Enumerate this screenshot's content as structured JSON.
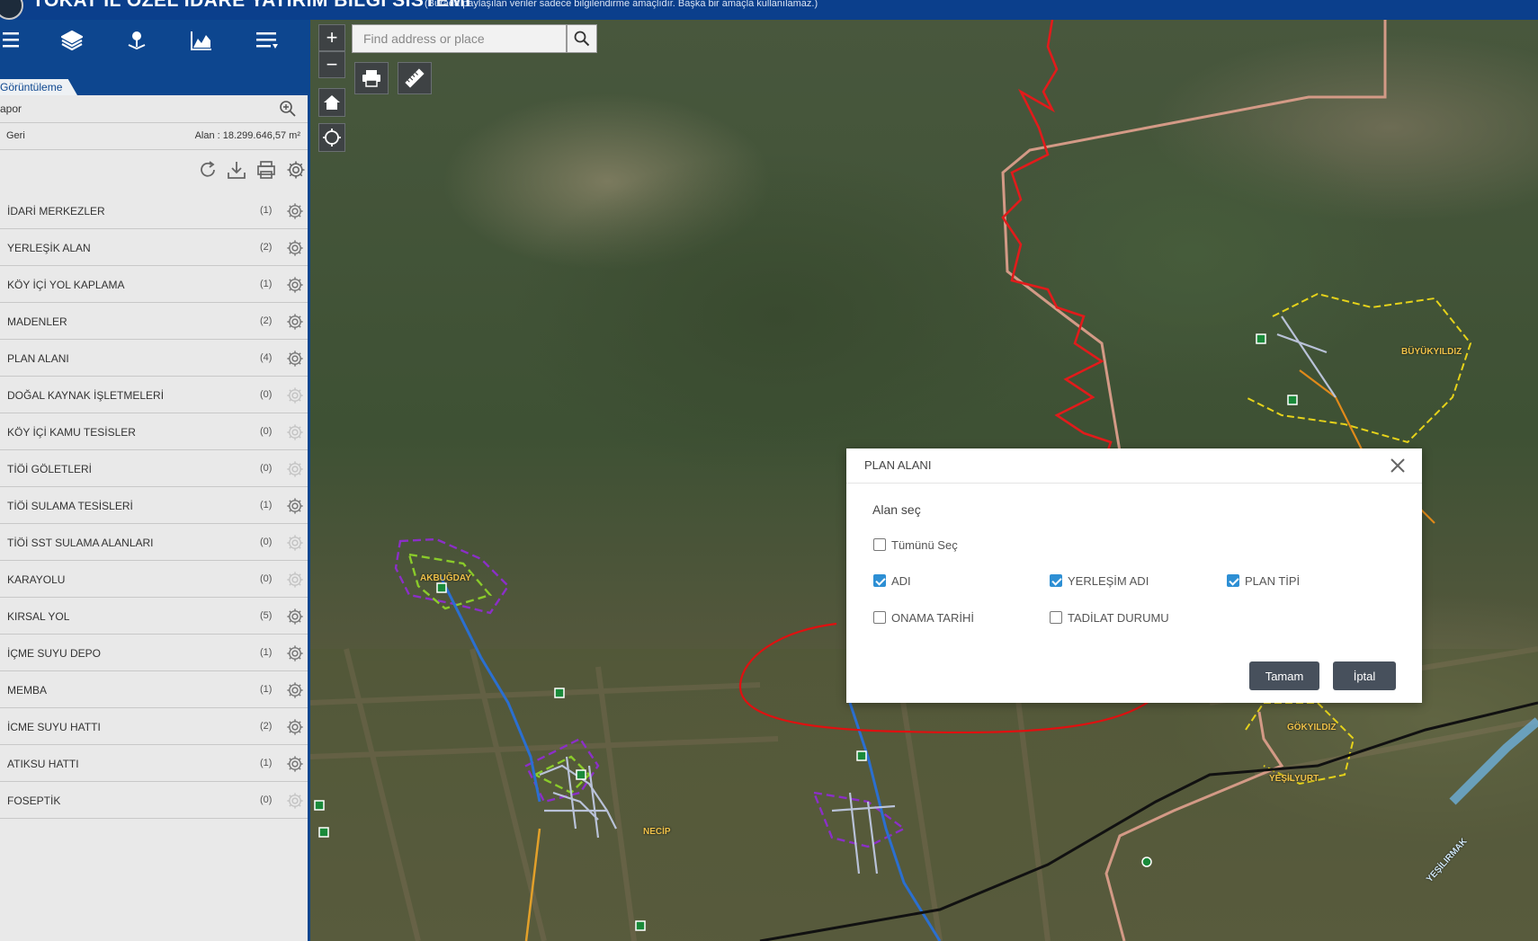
{
  "header": {
    "title": "TOKAT İL ÖZEL İDARE YATIRIM BİLGİ SİSTEMİ",
    "subtitle": "(Burada paylaşılan veriler sadece bilgilendirme amaçlıdır. Başka bir amaçla kullanılamaz.)"
  },
  "toolbar": {
    "icons": [
      "list-icon",
      "layers-icon",
      "location-pin-icon",
      "chart-icon",
      "menu-icon"
    ]
  },
  "panel": {
    "tab_label": "Görüntüleme",
    "rapor_label": "apor",
    "back_label": "Geri",
    "area_label": "Alan : 18.299.646,57 m²"
  },
  "layers": [
    {
      "name": "İDARİ MERKEZLER",
      "count": "(1)"
    },
    {
      "name": "YERLEŞİK ALAN",
      "count": "(2)"
    },
    {
      "name": "KÖY İÇİ YOL KAPLAMA",
      "count": "(1)"
    },
    {
      "name": "MADENLER",
      "count": "(2)"
    },
    {
      "name": "PLAN ALANI",
      "count": "(4)"
    },
    {
      "name": "DOĞAL KAYNAK İŞLETMELERİ",
      "count": "(0)"
    },
    {
      "name": "KÖY İÇİ KAMU TESİSLER",
      "count": "(0)"
    },
    {
      "name": "TİÖİ GÖLETLERİ",
      "count": "(0)"
    },
    {
      "name": "TİÖİ SULAMA TESİSLERİ",
      "count": "(1)"
    },
    {
      "name": "TİÖİ SST SULAMA ALANLARI",
      "count": "(0)"
    },
    {
      "name": "KARAYOLU",
      "count": "(0)"
    },
    {
      "name": "KIRSAL YOL",
      "count": "(5)"
    },
    {
      "name": "İÇME SUYU DEPO",
      "count": "(1)"
    },
    {
      "name": "MEMBA",
      "count": "(1)"
    },
    {
      "name": "İCME SUYU HATTI",
      "count": "(2)"
    },
    {
      "name": "ATIKSU HATTI",
      "count": "(1)"
    },
    {
      "name": "FOSEPTİK",
      "count": "(0)"
    }
  ],
  "map": {
    "zoom_in": "+",
    "zoom_out": "−",
    "search_placeholder": "Find address or place",
    "place_labels": {
      "akbugday": "AKBUĞDAY",
      "necip": "NECİP",
      "buyukyildiz": "BÜYÜKYILDIZ",
      "yesilyurt": "YEŞİLYURT",
      "gokyildiz": "GÖKYILDIZ",
      "yesilirmak": "YEŞİLIRMAK"
    }
  },
  "dialog": {
    "title": "PLAN ALANI",
    "subtitle": "Alan seç",
    "select_all": "Tümünü Seç",
    "fields": [
      {
        "label": "ADI",
        "checked": true
      },
      {
        "label": "YERLEŞİM ADI",
        "checked": true
      },
      {
        "label": "PLAN TİPİ",
        "checked": true
      },
      {
        "label": "ONAMA TARİHİ",
        "checked": false
      },
      {
        "label": "TADİLAT DURUMU",
        "checked": false
      }
    ],
    "ok_label": "Tamam",
    "cancel_label": "İptal"
  },
  "colors": {
    "header_blue": "#0b3f8c",
    "checkbox_blue": "#2d8fd4",
    "button_gray": "#47505c",
    "annotation_red": "#e01010"
  }
}
